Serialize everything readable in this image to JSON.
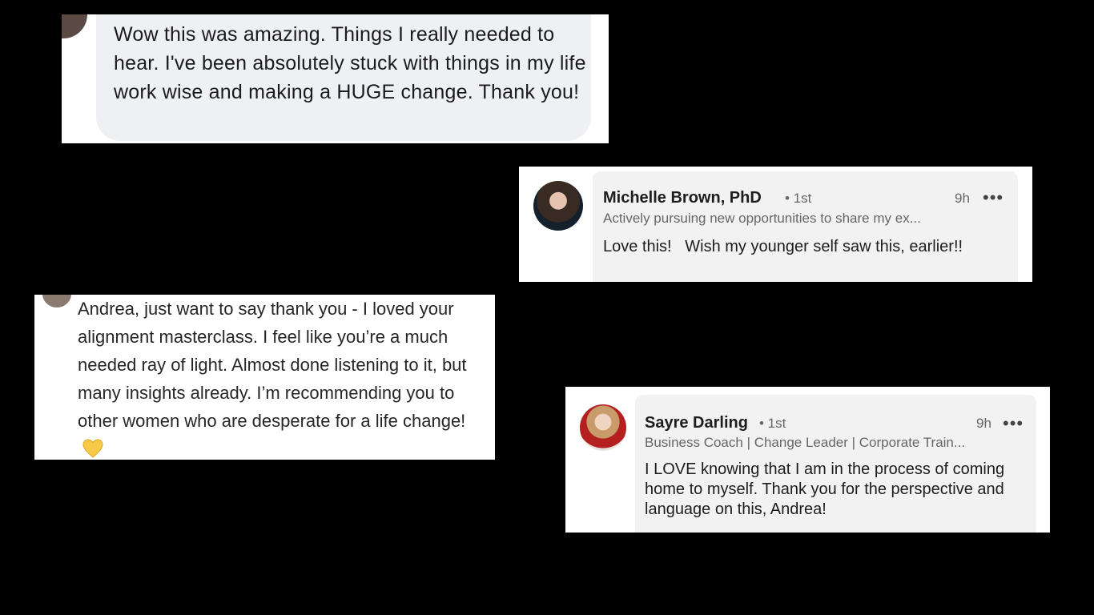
{
  "cards": [
    {
      "text": "Wow this was amazing. Things I really needed to hear.  I've been absolutely stuck with things in my life work wise and making a HUGE change. Thank you!"
    },
    {
      "name": "Michelle Brown, PhD",
      "degree": "• 1st",
      "time": "9h",
      "menu": "•••",
      "headline": "Actively pursuing new opportunities to share my ex...",
      "comment": "Love this!   Wish my younger self saw this, earlier!!"
    },
    {
      "text": "Andrea, just want to say thank you - I loved your alignment masterclass. I feel like you’re a much needed ray of light. Almost done listening to it, but many insights already. I’m recommending you to other women who are desperate for a life change!",
      "emoji": "yellow-heart-icon",
      "emoji_color": "#f7c948"
    },
    {
      "name": "Sayre Darling",
      "degree": "• 1st",
      "time": "9h",
      "menu": "•••",
      "headline": "Business Coach | Change Leader | Corporate Train...",
      "comment": "I LOVE knowing that I am in the process of coming home to myself. Thank you for the perspective and language on this, Andrea!"
    }
  ]
}
